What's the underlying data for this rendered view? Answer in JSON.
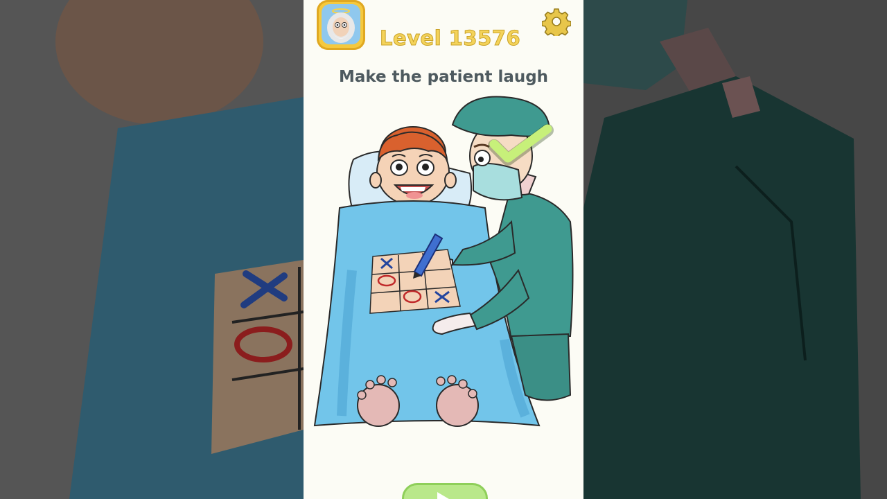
{
  "header": {
    "level_label": "Level 13576",
    "app_icon": "old-man-avatar-icon",
    "settings_icon": "gear-icon"
  },
  "puzzle": {
    "instruction": "Make the patient laugh",
    "board": [
      [
        "X",
        "",
        ""
      ],
      [
        "O",
        "",
        ""
      ],
      [
        "",
        "O",
        "X"
      ]
    ]
  },
  "footer": {
    "next_icon": "play-arrow-icon"
  },
  "colors": {
    "level_text": "#f4d35a",
    "instruction_text": "#4e5a5f",
    "scrubs": "#3f9a90",
    "blanket": "#72c5ea",
    "check": "#c7f07a"
  }
}
